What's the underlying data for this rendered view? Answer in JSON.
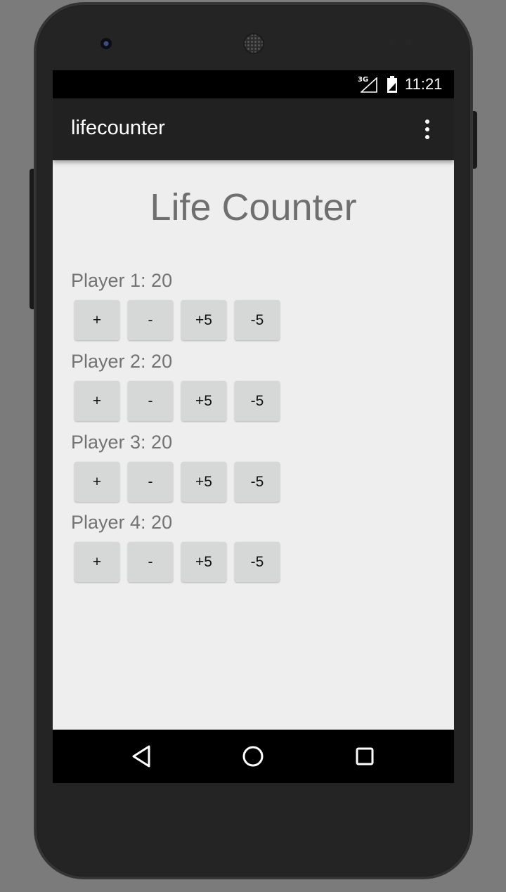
{
  "status_bar": {
    "network": "3G",
    "time": "11:21"
  },
  "app_bar": {
    "title": "lifecounter",
    "overflow_icon": "more-vert-icon"
  },
  "main": {
    "heading": "Life Counter",
    "players": [
      {
        "label": "Player 1: 20"
      },
      {
        "label": "Player 2: 20"
      },
      {
        "label": "Player 3: 20"
      },
      {
        "label": "Player 4: 20"
      }
    ],
    "buttons": [
      "+",
      "-",
      "+5",
      "-5"
    ]
  },
  "nav_bar": {
    "icons": [
      "back-icon",
      "home-icon",
      "recents-icon"
    ]
  },
  "colors": {
    "app_bar": "#212121",
    "content_bg": "#eeeeee",
    "button_bg": "#d6d7d7",
    "heading_text": "#6f6f6f"
  }
}
